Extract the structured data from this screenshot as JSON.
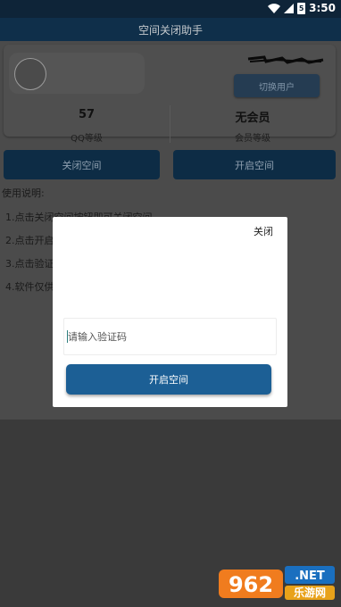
{
  "status_bar": {
    "time": "3:50",
    "battery_badge": "5"
  },
  "app": {
    "title": "空间关闭助手"
  },
  "profile": {
    "switch_user_label": "切换用户",
    "qq_level_value": "57",
    "qq_level_label": "QQ等级",
    "member_value": "无会员",
    "member_label": "会员等级"
  },
  "actions": {
    "close_space": "关闭空间",
    "open_space": "开启空间"
  },
  "instructions": {
    "heading": "使用说明:",
    "lines": [
      "1.点击关闭空间按钮即可关闭空间",
      "2.点击开启",
      "3.点击验证",
      "4.软件仅供"
    ]
  },
  "dialog": {
    "close_label": "关闭",
    "code_placeholder": "请输入验证码",
    "open_button": "开启空间"
  },
  "watermark": {
    "number": "962",
    "net": ".NET",
    "site": "乐游网"
  },
  "colors": {
    "status_bar": "#0e2438",
    "title_bar": "#0f2f4a",
    "primary_button": "#1c5f95",
    "dim_overlay": "#4b4b4b"
  }
}
